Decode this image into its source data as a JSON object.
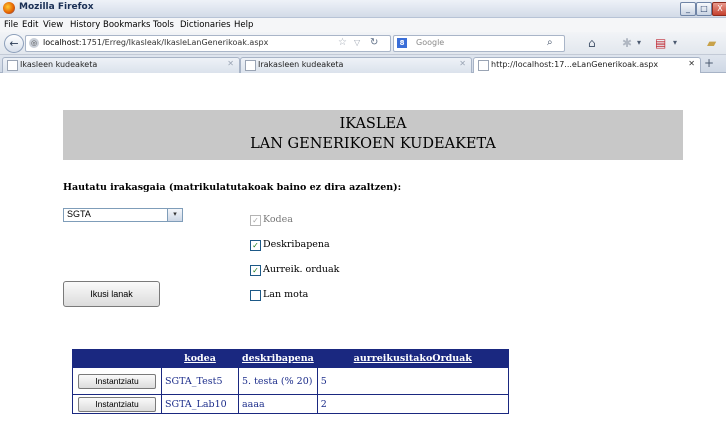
{
  "window": {
    "title": "Mozilla Firefox",
    "minimize": "_",
    "maximize": "□",
    "close": "X"
  },
  "menu": [
    "File",
    "Edit",
    "View",
    "History",
    "Bookmarks",
    "Tools",
    "Dictionaries",
    "Help"
  ],
  "navbar": {
    "url_host": "localhost",
    "url_rest": ":1751/Erreg/Ikasleak/IkasleLanGenerikoak.aspx",
    "search_placeholder": "Google"
  },
  "tabs": [
    {
      "label": "Ikasleen kudeaketa",
      "active": false
    },
    {
      "label": "Irakasleen kudeaketa",
      "active": false
    },
    {
      "label": "http://localhost:17...eLanGenerikoak.aspx",
      "active": true
    }
  ],
  "page": {
    "heading_line1": "IKASLEA",
    "heading_line2": "LAN GENERIKOEN KUDEAKETA",
    "prompt": "Hautatu irakasgaia (matrikulatutakoak baino ez dira azaltzen):",
    "subject_selected": "SGTA",
    "checkboxes": [
      {
        "label": "Kodea",
        "checked": true,
        "disabled": true
      },
      {
        "label": "Deskribapena",
        "checked": true,
        "disabled": false
      },
      {
        "label": "Aurreik. orduak",
        "checked": true,
        "disabled": false
      },
      {
        "label": "Lan mota",
        "checked": false,
        "disabled": false
      }
    ],
    "show_button": "Ikusi lanak"
  },
  "grid": {
    "headers": [
      "",
      "kodea",
      "deskribapena",
      "aurreikusitakoOrduak"
    ],
    "rows": [
      {
        "button": "Instantziatu",
        "kodea": "SGTA_Test5",
        "deskribapena": "5. testa (% 20)",
        "orduak": "5"
      },
      {
        "button": "Instantziatu",
        "kodea": "SGTA_Lab10",
        "deskribapena": "aaaa",
        "orduak": "2"
      }
    ]
  }
}
